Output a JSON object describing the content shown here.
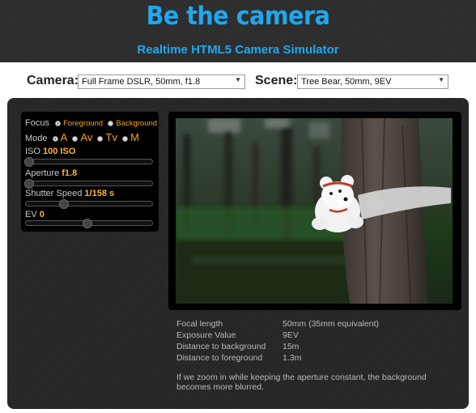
{
  "header": {
    "brand": "Be the camera",
    "subtitle": "Realtime HTML5 Camera Simulator"
  },
  "camera": {
    "label": "Camera:",
    "selected": "Full Frame DSLR, 50mm, f1.8"
  },
  "scene": {
    "label": "Scene:",
    "selected": "Tree Bear, 50mm, 9EV"
  },
  "controls": {
    "focus_label": "Focus",
    "focus_options": [
      "Foreground",
      "Background"
    ],
    "focus_selected": "Foreground",
    "mode_label": "Mode",
    "mode_options": [
      "A",
      "Av",
      "Tv",
      "M"
    ],
    "mode_selected": "A",
    "iso_label": "ISO",
    "iso_value": "100 ISO",
    "iso_level": 0.0,
    "aperture_label": "Aperture",
    "aperture_value": "f1.8",
    "aperture_level": 0.0,
    "shutter_label": "Shutter Speed",
    "shutter_value": "1/158 s",
    "shutter_level": 0.3,
    "ev_label": "EV",
    "ev_value": "0",
    "ev_level": 0.5
  },
  "info": {
    "rows": [
      {
        "key": "Focal length",
        "value": "50mm (35mm equivalent)"
      },
      {
        "key": "Exposure Value",
        "value": "9EV"
      },
      {
        "key": "Distance to background",
        "value": "15m"
      },
      {
        "key": "Distance to foreground",
        "value": "1.3m"
      }
    ],
    "note": "If we zoom in while keeping the aperture constant, the background becomes more blurred."
  },
  "colors": {
    "accent": "#1ea8ef",
    "value": "#f7b733",
    "panel": "#262626"
  }
}
